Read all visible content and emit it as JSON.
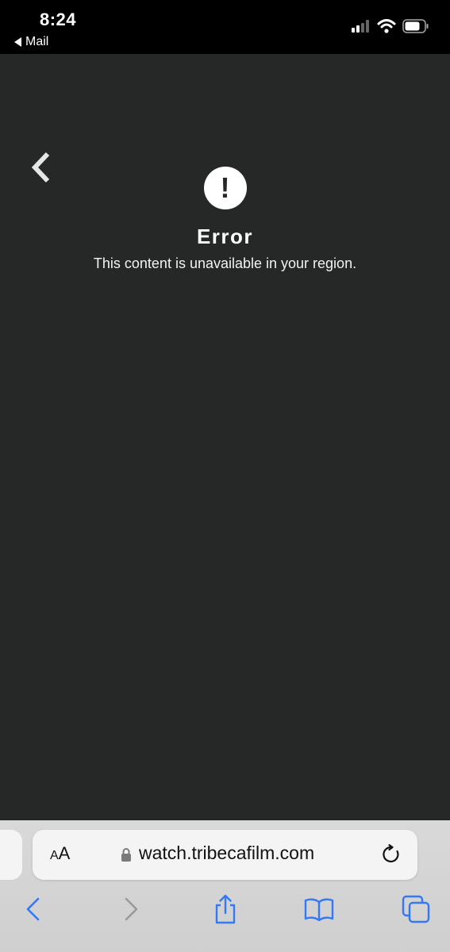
{
  "status_bar": {
    "time": "8:24",
    "back_app": "Mail"
  },
  "error": {
    "icon": "!",
    "title": "Error",
    "message": "This content is unavailable in your region."
  },
  "browser": {
    "text_size_label_small": "A",
    "text_size_label_large": "A",
    "url": "watch.tribecafilm.com"
  },
  "colors": {
    "page_background": "#262727",
    "status_bar_background": "#000000",
    "toolbar_accent": "#3478f6"
  },
  "icons": {
    "status": [
      "cellular-signal-icon",
      "wifi-icon",
      "battery-icon"
    ],
    "toolbar": [
      "back-icon",
      "forward-icon",
      "share-icon",
      "bookmarks-icon",
      "tabs-icon"
    ]
  }
}
